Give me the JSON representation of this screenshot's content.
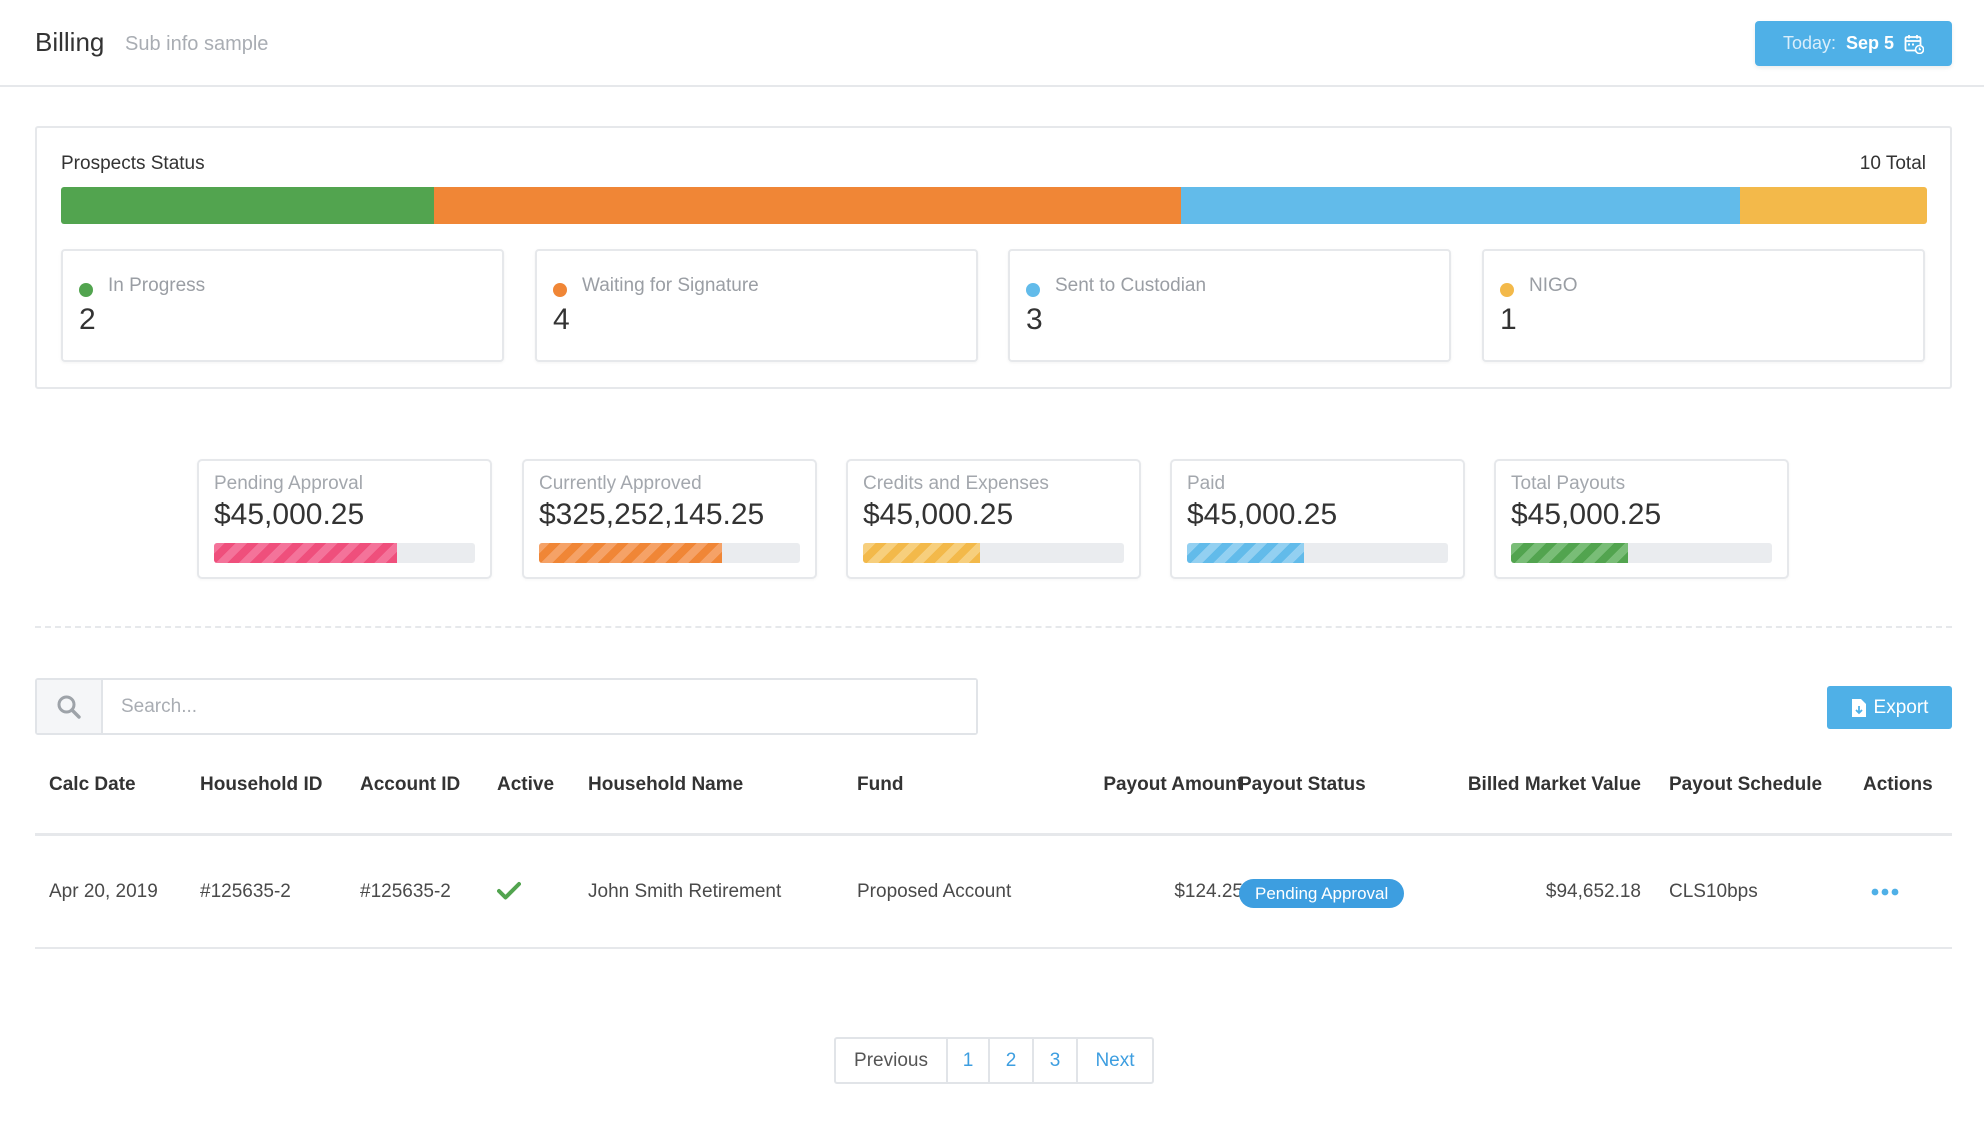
{
  "header": {
    "title": "Billing",
    "subtitle": "Sub info sample",
    "today_label": "Today:",
    "today_value": "Sep 5",
    "calendar_icon": "calendar-icon"
  },
  "prospects": {
    "title": "Prospects Status",
    "total_label": "10 Total",
    "statuses": [
      {
        "label": "In Progress",
        "count": "2",
        "value": 2,
        "color": "#52a44f"
      },
      {
        "label": "Waiting for Signature",
        "count": "4",
        "value": 4,
        "color": "#f08636"
      },
      {
        "label": "Sent to Custodian",
        "count": "3",
        "value": 3,
        "color": "#62bbea"
      },
      {
        "label": "NIGO",
        "count": "1",
        "value": 1,
        "color": "#f3b94a"
      }
    ]
  },
  "metrics": [
    {
      "label": "Pending Approval",
      "value": "$45,000.25",
      "progress": 0.7,
      "color": "#ef4f7c",
      "stripe": "#f4739a"
    },
    {
      "label": "Currently Approved",
      "value": "$325,252,145.25",
      "progress": 0.7,
      "color": "#f08636",
      "stripe": "#f5a267"
    },
    {
      "label": "Credits and Expenses",
      "value": "$45,000.25",
      "progress": 0.45,
      "color": "#f3b94a",
      "stripe": "#f7cf7d"
    },
    {
      "label": "Paid",
      "value": "$45,000.25",
      "progress": 0.45,
      "color": "#62bbea",
      "stripe": "#93d0f1"
    },
    {
      "label": "Total Payouts",
      "value": "$45,000.25",
      "progress": 0.45,
      "color": "#52a44f",
      "stripe": "#79bd77"
    }
  ],
  "search": {
    "placeholder": "Search...",
    "icon": "search-icon"
  },
  "export": {
    "label": "Export",
    "icon": "file-export-icon"
  },
  "table": {
    "columns": [
      "Calc Date",
      "Household ID",
      "Account ID",
      "Active",
      "Household Name",
      "Fund",
      "Payout Amount",
      "Payout Status",
      "Billed Market Value",
      "Payout Schedule",
      "Actions"
    ],
    "rows": [
      {
        "calc_date": "Apr 20, 2019",
        "household_id": "#125635-2",
        "account_id": "#125635-2",
        "active_icon": "check-icon",
        "household_name": "John Smith Retirement",
        "fund": "Proposed Account",
        "payout_amount": "$124.25",
        "payout_status": "Pending Approval",
        "billed_market_value": "$94,652.18",
        "payout_schedule": "CLS10bps",
        "actions_icon": "ellipsis-icon"
      }
    ]
  },
  "pagination": {
    "previous": "Previous",
    "pages": [
      "1",
      "2",
      "3"
    ],
    "next": "Next"
  }
}
